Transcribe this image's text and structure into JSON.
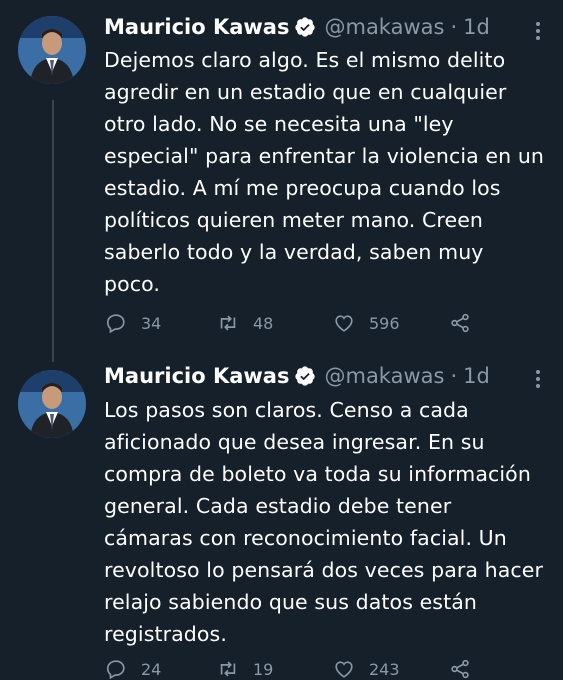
{
  "tweets": [
    {
      "author_name": "Mauricio Kawas",
      "handle": "@makawas",
      "separator": "·",
      "time": "1d",
      "text": "Dejemos claro algo. Es el mismo delito agredir en un estadio que en cualquier otro lado. No se necesita una \"ley especial\" para enfrentar la violencia en un estadio. A mí me preocupa cuando los políticos quieren meter mano. Creen saberlo todo y la verdad, saben muy poco.",
      "replies": "34",
      "retweets": "48",
      "likes": "596"
    },
    {
      "author_name": "Mauricio Kawas",
      "handle": "@makawas",
      "separator": "·",
      "time": "1d",
      "text": "Los pasos son claros. Censo a cada aficionado que desea ingresar. En su compra de boleto va toda su información general. Cada estadio debe tener cámaras con reconocimiento facial. Un revoltoso lo pensará dos veces para hacer relajo sabiendo que sus datos están registrados.",
      "replies": "24",
      "retweets": "19",
      "likes": "243"
    }
  ],
  "colors": {
    "background": "#15202b",
    "secondary_text": "#8b98a5",
    "verified_badge": "#ffffff"
  },
  "icons": [
    "verified-badge-icon",
    "more-icon",
    "reply-icon",
    "retweet-icon",
    "like-icon",
    "share-icon"
  ]
}
